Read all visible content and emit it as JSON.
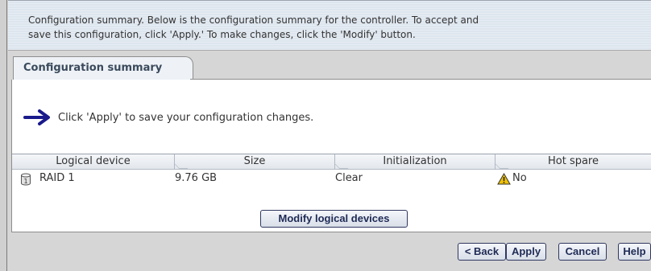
{
  "description": {
    "line1": "Configuration summary. Below is the configuration summary for the controller.  To accept and",
    "line2": "save this configuration, click 'Apply.'  To make changes, click the 'Modify' button."
  },
  "tab": {
    "label": "Configuration summary"
  },
  "instruction": {
    "text": "Click 'Apply' to save your configuration changes.",
    "icon": "arrow-right-icon"
  },
  "table": {
    "headers": [
      "Logical device",
      "Size",
      "Initialization",
      "Hot spare"
    ],
    "rows": [
      {
        "device": "RAID 1",
        "size": "9.76 GB",
        "initialization": "Clear",
        "hot_spare": "No",
        "device_icon": "disk-icon",
        "hot_spare_icon": "warning-icon"
      }
    ]
  },
  "modify_button": {
    "label": "Modify logical devices"
  },
  "footer": {
    "back": "< Back",
    "apply": "Apply",
    "cancel": "Cancel",
    "help": "Help"
  },
  "colors": {
    "arrow": "#1a1a8c",
    "warning": "#f2c200",
    "button_border": "#303860"
  }
}
